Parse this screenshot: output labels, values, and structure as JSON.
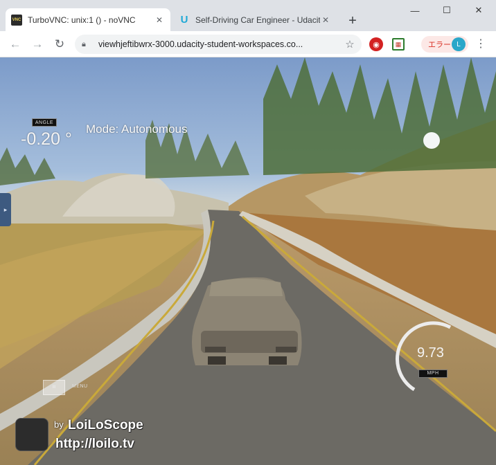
{
  "browser": {
    "tabs": [
      {
        "title": "TurboVNC: unix:1 () - noVNC",
        "favicon": "vnc-icon",
        "active": true
      },
      {
        "title": "Self-Driving Car Engineer - Udacity",
        "favicon": "udacity-icon",
        "active": false
      }
    ],
    "new_tab_symbol": "+",
    "window_controls": {
      "minimize": "—",
      "maximize": "☐",
      "close": "✕"
    },
    "address_bar": {
      "url": "viewhjeftibwrx-3000.udacity-student-workspaces.co..."
    },
    "error_badge": {
      "label": "エラー"
    },
    "colors": {
      "tabstrip": "#dee1e6",
      "toolbar": "#ffffff",
      "error": "#d93025"
    }
  },
  "simulator": {
    "angle_label": "ANGLE",
    "angle_value": "-0.20 °",
    "mode_text": "Mode: Autonomous",
    "menu_button_label": "III",
    "menu_label": "MENU",
    "speed_value": "9.73",
    "speed_unit": "MPH"
  },
  "watermark": {
    "by": "by",
    "brand": "LoiLoScope",
    "url": "http://loilo.tv"
  }
}
